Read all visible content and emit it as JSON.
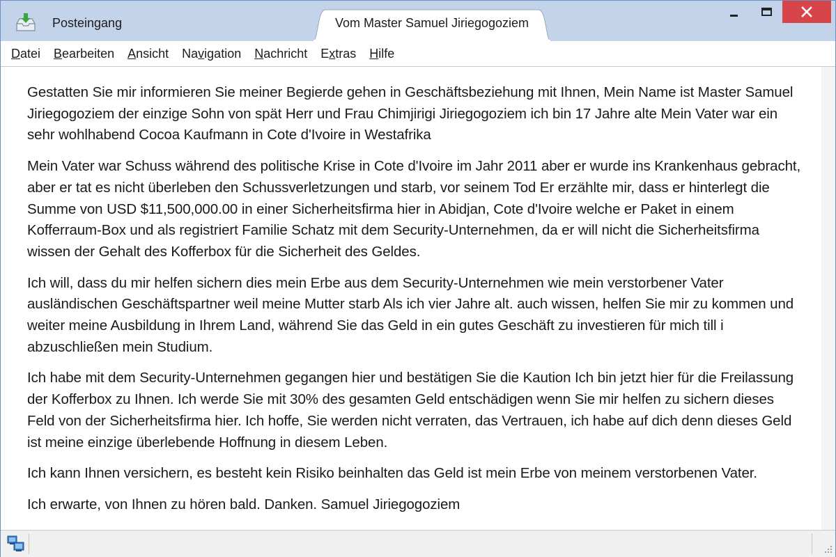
{
  "window": {
    "tabs": [
      {
        "label": "Posteingang",
        "icon": "inbox-download-icon",
        "active": false
      },
      {
        "label": "Vom Master Samuel Jiriegogoziem",
        "active": true
      }
    ],
    "controls": [
      "minimize-icon",
      "maximize-icon",
      "close-icon"
    ],
    "close_color": "#d7454a",
    "titlebar_color": "#c3d4ea"
  },
  "menu": {
    "items": [
      {
        "label": "Datei",
        "accel": "D",
        "rest": "atei"
      },
      {
        "label": "Bearbeiten",
        "accel": "B",
        "rest": "earbeiten"
      },
      {
        "label": "Ansicht",
        "accel": "A",
        "rest": "nsicht"
      },
      {
        "label": "Navigation",
        "pre": "Na",
        "accel": "v",
        "rest": "igation"
      },
      {
        "label": "Nachricht",
        "accel": "N",
        "rest": "achricht"
      },
      {
        "label": "Extras",
        "pre": "E",
        "accel": "x",
        "rest": "tras"
      },
      {
        "label": "Hilfe",
        "accel": "H",
        "rest": "ilfe"
      }
    ]
  },
  "message": {
    "paragraphs": [
      "Gestatten Sie mir informieren Sie meiner Begierde gehen in Geschäftsbeziehung mit Ihnen, Mein Name ist Master Samuel Jiriegogoziem der einzige Sohn von spät Herr und Frau Chimjirigi Jiriegogoziem ich bin 17 Jahre alte Mein Vater war ein sehr wohlhabend Cocoa Kaufmann in Cote d'Ivoire in Westafrika",
      "Mein Vater war Schuss während des politische Krise in Cote d'Ivoire im Jahr 2011 aber er wurde ins Krankenhaus gebracht, aber er tat es nicht überleben den Schussverletzungen und starb, vor seinem Tod Er erzählte mir, dass er hinterlegt die Summe von USD $11,500,000.00 in einer Sicherheitsfirma hier in Abidjan, Cote d'Ivoire welche er Paket in einem Kofferraum-Box und als registriert Familie Schatz mit dem Security-Unternehmen, da er will nicht die Sicherheitsfirma wissen der Gehalt des Kofferbox für die Sicherheit des Geldes.",
      "Ich will, dass du mir helfen sichern dies mein Erbe aus dem Security-Unternehmen wie mein verstorbener Vater ausländischen Geschäftspartner weil meine Mutter starb Als ich vier Jahre alt. auch wissen, helfen Sie mir zu kommen und weiter meine Ausbildung in Ihrem Land, während Sie das Geld in ein gutes Geschäft zu investieren für mich till i abzuschließen mein Studium.",
      "Ich habe mit dem Security-Unternehmen gegangen hier und bestätigen Sie die Kaution Ich bin jetzt hier für die Freilassung der Kofferbox zu Ihnen. Ich werde Sie mit 30% des gesamten Geld entschädigen wenn Sie mir helfen zu sichern dieses Feld von der Sicherheitsfirma hier. Ich hoffe, Sie werden nicht verraten, das Vertrauen, ich habe auf dich denn dieses Geld ist meine einzige überlebende Hoffnung in diesem Leben.",
      "Ich kann Ihnen versichern, es besteht kein Risiko beinhalten das Geld ist mein Erbe von meinem verstorbenen Vater.",
      "Ich erwarte, von Ihnen zu hören bald. Danken. Samuel Jiriegogoziem"
    ]
  },
  "statusbar": {
    "icon": "network-status-icon"
  }
}
